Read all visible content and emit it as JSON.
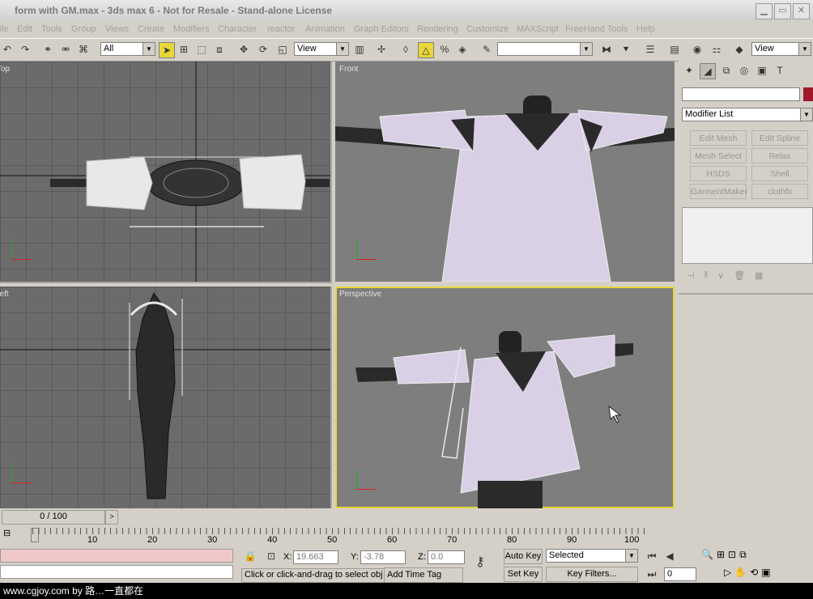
{
  "window": {
    "title": "form with GM.max - 3ds max 6 - Not for Resale - Stand-alone License"
  },
  "menu": [
    "File",
    "Edit",
    "Tools",
    "Group",
    "Views",
    "Create",
    "Modifiers",
    "Character",
    "reactor",
    "Animation",
    "Graph Editors",
    "Rendering",
    "Customize",
    "MAXScript",
    "FreeHand Tools",
    "Help"
  ],
  "toolbar": {
    "filter": "All",
    "ref_coord": "View",
    "named_sel": "",
    "view_right": "View"
  },
  "viewports": {
    "top": "Top",
    "front": "Front",
    "left": "Left",
    "perspective": "Perspective"
  },
  "command_panel": {
    "modifier_list": "Modifier List",
    "modifier_buttons": [
      "Edit Mesh",
      "Edit Spline",
      "Mesh Select",
      "Relax",
      "HSDS",
      "Shell",
      "GarmentMaker",
      "clothfx"
    ]
  },
  "timeline": {
    "frame": "0 / 100",
    "ticks": [
      "10",
      "20",
      "30",
      "40",
      "50",
      "60",
      "70",
      "80",
      "90",
      "100"
    ]
  },
  "status": {
    "x_label": "X:",
    "x": "19.663",
    "y_label": "Y:",
    "y": "-3.78",
    "z_label": "Z:",
    "z": "0.0",
    "prompt": "Click or click-and-drag to select obj",
    "add_time_tag": "Add Time Tag",
    "auto_key": "Auto Key",
    "set_key": "Set Key",
    "selected": "Selected",
    "key_filters": "Key Filters...",
    "frame_field": "0"
  },
  "footer": {
    "text": "www.cgjoy.com by 路…一直都在"
  },
  "colors": {
    "accent_active_viewport": "#e8d63a",
    "cloth": "#d9d0e6",
    "mesh": "#222222"
  }
}
